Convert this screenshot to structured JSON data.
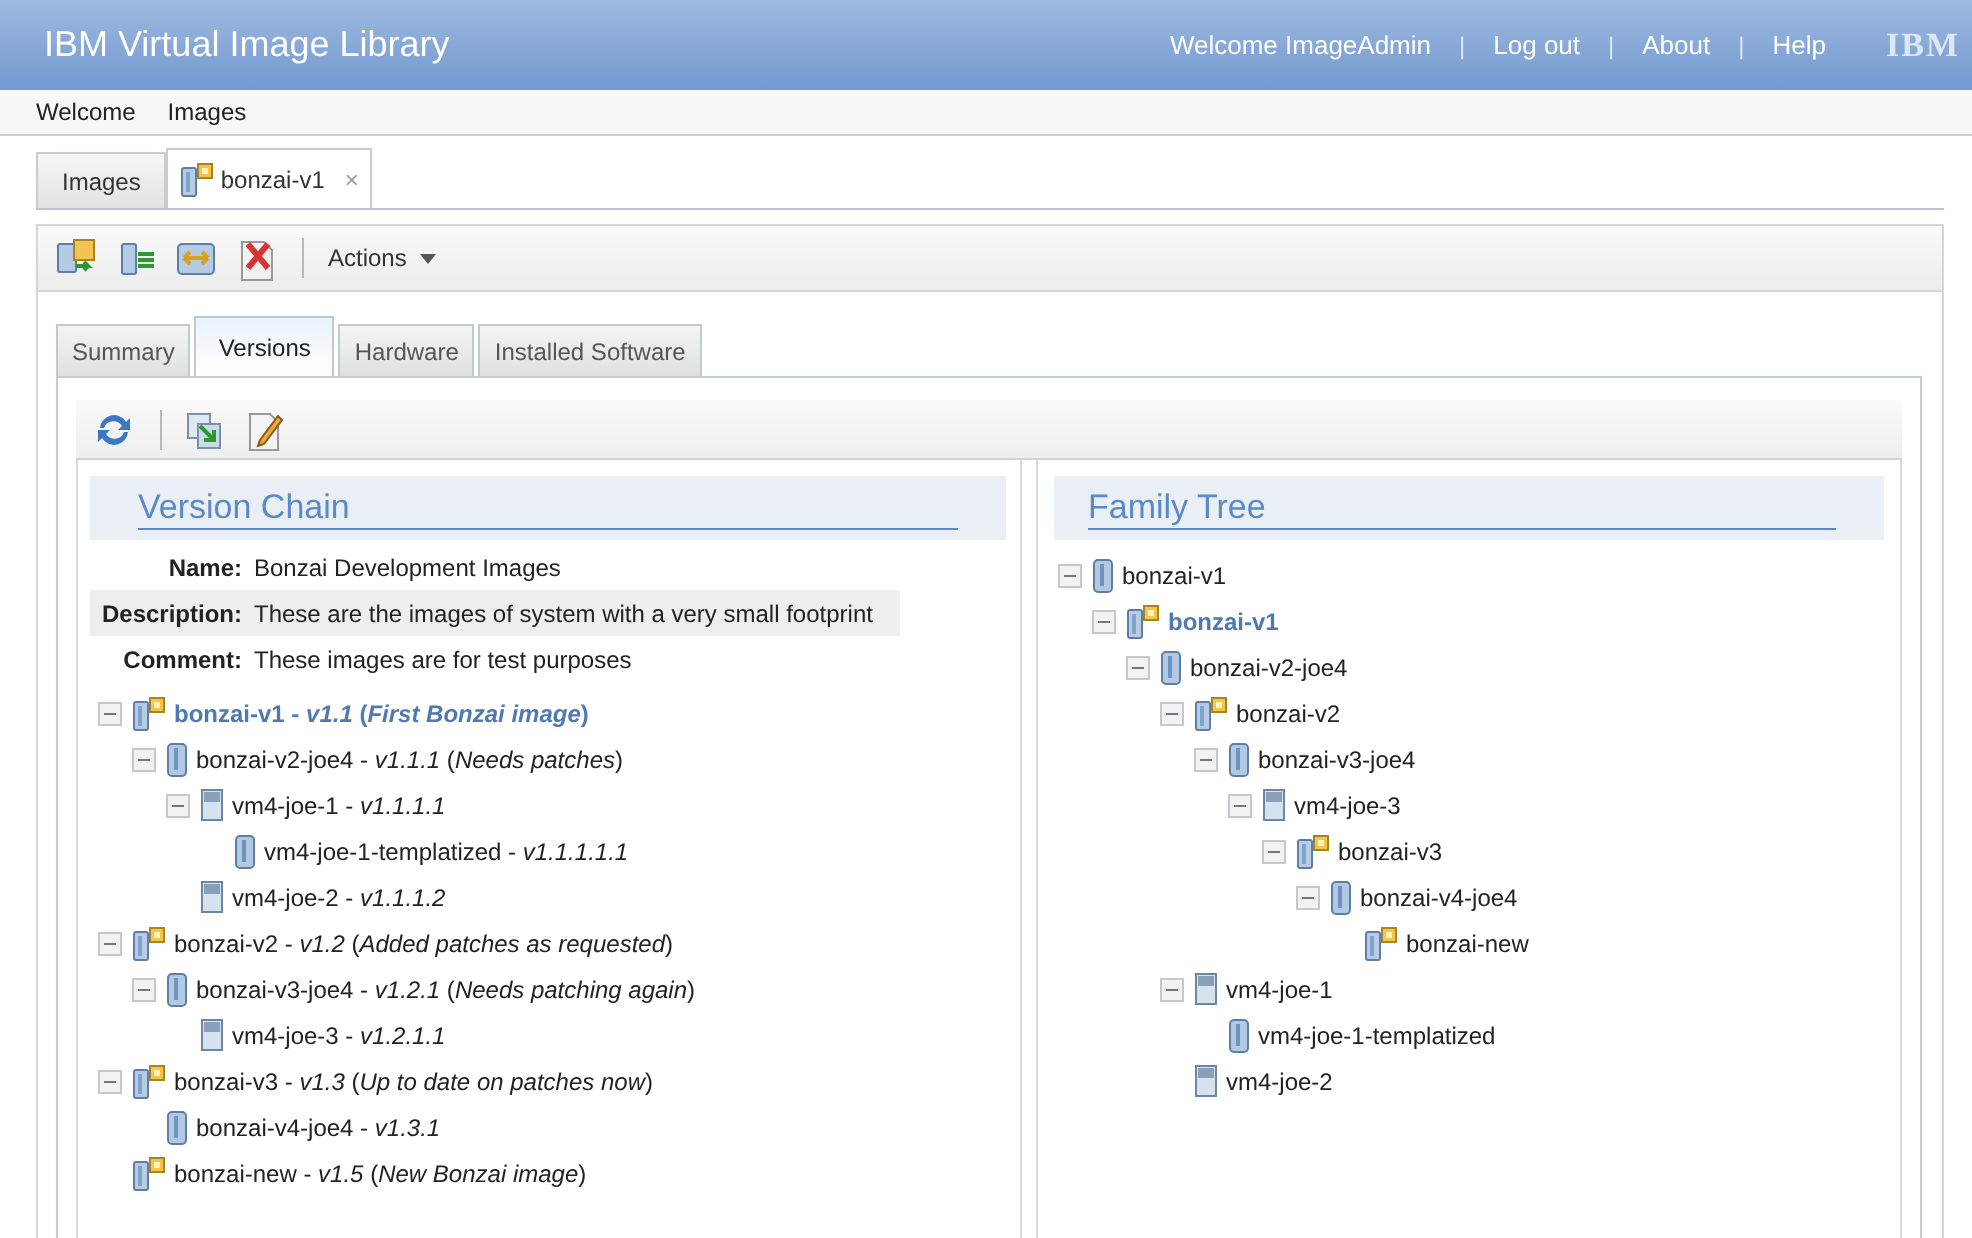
{
  "header": {
    "title": "IBM Virtual Image Library",
    "welcome": "Welcome ImageAdmin",
    "separator": "|",
    "links": [
      "Log out",
      "About",
      "Help"
    ],
    "logo": "IBM"
  },
  "menu": [
    "Welcome",
    "Images"
  ],
  "doc_tabs": [
    {
      "label": "Images",
      "selected": false,
      "closable": false
    },
    {
      "label": "bonzai-v1",
      "selected": true,
      "closable": true,
      "close": "×"
    }
  ],
  "toolbar": {
    "actions": "Actions"
  },
  "tabs": [
    {
      "label": "Summary",
      "selected": false
    },
    {
      "label": "Versions",
      "selected": true
    },
    {
      "label": "Hardware",
      "selected": false
    },
    {
      "label": "Installed Software",
      "selected": false
    }
  ],
  "version_chain": {
    "title": "Version Chain",
    "fields": [
      {
        "label": "Name:",
        "value": "Bonzai Development Images",
        "highlighted": false
      },
      {
        "label": "Description:",
        "value": "These are the images of system with a very small footprint",
        "highlighted": true
      },
      {
        "label": "Comment:",
        "value": "These images are for test purposes",
        "highlighted": false
      }
    ],
    "tree": [
      {
        "kind": "image",
        "label": "bonzai-v1 - *v1.1* (*First Bonzai image*)",
        "selected": true,
        "expanded": true,
        "children": [
          {
            "kind": "virtual",
            "label": "bonzai-v2-joe4 - *v1.1.1* (*Needs patches*)",
            "selected": false,
            "expanded": true,
            "children": [
              {
                "kind": "vm",
                "label": "vm4-joe-1 - *v1.1.1.1*",
                "selected": false,
                "expanded": true,
                "children": [
                  {
                    "kind": "virtual",
                    "label": "vm4-joe-1-templatized - *v1.1.1.1.1*",
                    "selected": false
                  }
                ]
              },
              {
                "kind": "vm",
                "label": "vm4-joe-2 - *v1.1.1.2*",
                "selected": false
              }
            ]
          }
        ]
      },
      {
        "kind": "image",
        "label": "bonzai-v2 - *v1.2* (*Added patches as requested*)",
        "selected": false,
        "expanded": true,
        "children": [
          {
            "kind": "virtual",
            "label": "bonzai-v3-joe4 - *v1.2.1* (*Needs patching again*)",
            "selected": false,
            "expanded": true,
            "children": [
              {
                "kind": "vm",
                "label": "vm4-joe-3 - *v1.2.1.1*",
                "selected": false
              }
            ]
          }
        ]
      },
      {
        "kind": "image",
        "label": "bonzai-v3 - *v1.3* (*Up to date on patches now*)",
        "selected": false,
        "expanded": true,
        "children": [
          {
            "kind": "virtual",
            "label": "bonzai-v4-joe4 - *v1.3.1*",
            "selected": false
          }
        ]
      },
      {
        "kind": "image",
        "label": "bonzai-new - *v1.5* (*New Bonzai image*)",
        "selected": false
      }
    ]
  },
  "family_tree": {
    "title": "Family Tree",
    "tree": [
      {
        "kind": "virtual",
        "label": "bonzai-v1",
        "selected": false,
        "expanded": true,
        "children": [
          {
            "kind": "image",
            "label": "bonzai-v1",
            "selected": true,
            "expanded": true,
            "children": [
              {
                "kind": "virtual",
                "label": "bonzai-v2-joe4",
                "selected": false,
                "expanded": true,
                "children": [
                  {
                    "kind": "image",
                    "label": "bonzai-v2",
                    "selected": false,
                    "expanded": true,
                    "children": [
                      {
                        "kind": "virtual",
                        "label": "bonzai-v3-joe4",
                        "selected": false,
                        "expanded": true,
                        "children": [
                          {
                            "kind": "vm",
                            "label": "vm4-joe-3",
                            "selected": false,
                            "expanded": true,
                            "children": [
                              {
                                "kind": "image",
                                "label": "bonzai-v3",
                                "selected": false,
                                "expanded": true,
                                "children": [
                                  {
                                    "kind": "virtual",
                                    "label": "bonzai-v4-joe4",
                                    "selected": false,
                                    "expanded": true,
                                    "children": [
                                      {
                                        "kind": "image",
                                        "label": "bonzai-new",
                                        "selected": false
                                      }
                                    ]
                                  }
                                ]
                              }
                            ]
                          }
                        ]
                      }
                    ]
                  },
                  {
                    "kind": "vm",
                    "label": "vm4-joe-1",
                    "selected": false,
                    "expanded": true,
                    "children": [
                      {
                        "kind": "virtual",
                        "label": "vm4-joe-1-templatized",
                        "selected": false
                      }
                    ]
                  },
                  {
                    "kind": "vm",
                    "label": "vm4-joe-2",
                    "selected": false
                  }
                ]
              }
            ]
          }
        ]
      }
    ]
  }
}
